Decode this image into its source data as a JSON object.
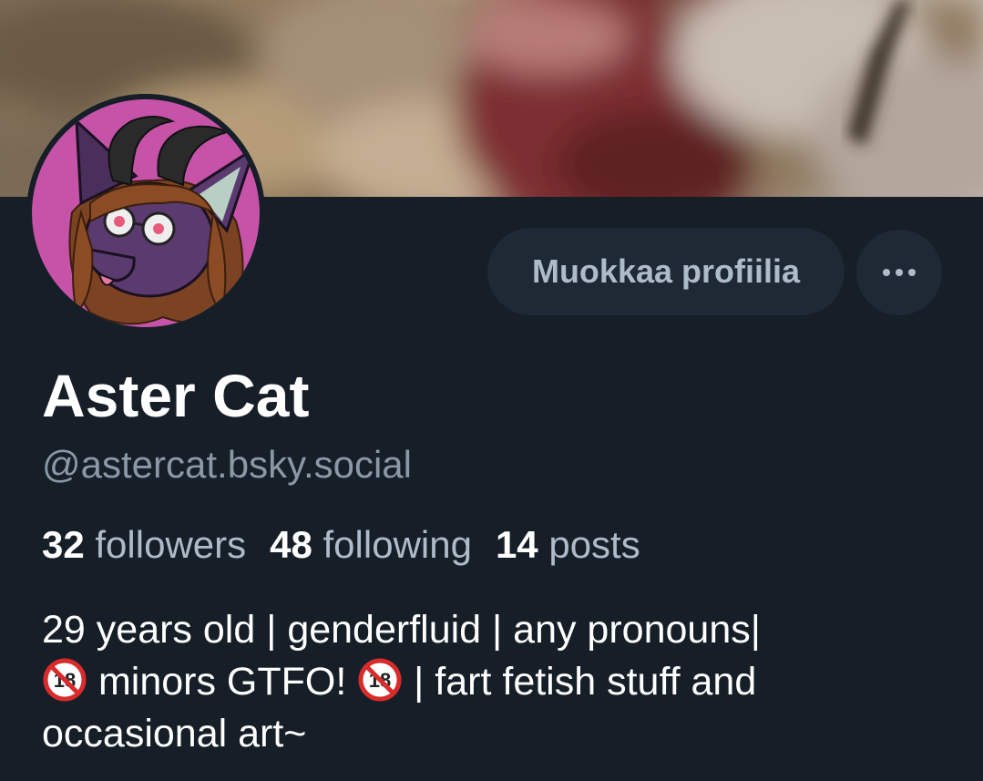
{
  "profile": {
    "display_name": "Aster Cat",
    "handle": "@astercat.bsky.social",
    "edit_button_label": "Muokkaa profiilia",
    "more_button_label": "···",
    "stats": {
      "followers_count": "32",
      "followers_label": "followers",
      "following_count": "48",
      "following_label": "following",
      "posts_count": "14",
      "posts_label": "posts"
    },
    "bio": {
      "line1": "29 years old | genderfluid | any pronouns|",
      "line2_part1": " minors GTFO! ",
      "line2_part2": " | fart fetish stuff and",
      "line3": "occasional art~",
      "emoji_no_under_18": "🔞"
    }
  },
  "icons": {
    "more": "more-horizontal-icon",
    "age_restriction": "no-under-18-icon"
  },
  "colors": {
    "background": "#161e27",
    "button_bg": "#1e2935",
    "muted_text": "#8b98a6",
    "label_text": "#aebbc9",
    "primary_text": "#ffffff",
    "avatar_bg": "#c653a8"
  }
}
